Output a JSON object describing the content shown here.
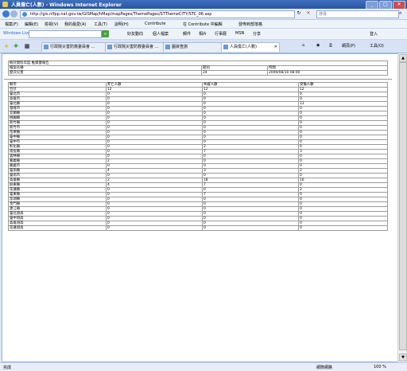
{
  "window": {
    "title": "人員傷亡(人數) - Windows Internet Explorer",
    "minimize": "_",
    "maximize": "□",
    "close": "✕"
  },
  "address": {
    "url": "http://gis.nlfpp.nat.gov.tw/GISMap/hMap/mapPages/ThemePages/STThemeCITY/STC_06.asp",
    "refresh": "↻",
    "stop": "✕"
  },
  "search": {
    "placeholder": "搜尋"
  },
  "menu": [
    "檔案(F)",
    "編輯(E)",
    "檢視(V)",
    "我的最愛(A)",
    "工具(T)",
    "說明(H)",
    "Contribute",
    "在 Contribute 中編輯",
    "發佈到部落格"
  ],
  "livebar": {
    "label": "Windows Live",
    "items": [
      "好友動向",
      "個人檔案",
      "郵件",
      "相片",
      "行事曆",
      "MSN",
      "分享"
    ],
    "signin": "登入"
  },
  "tabs": [
    "行政院災害防救委員會 ...",
    "行政院災害防救委員會 ...",
    "圖資查詢",
    "人員傷亡(人數)"
  ],
  "tab_close": "✕",
  "tools": {
    "page": "網頁(P)",
    "tools": "工具(O)"
  },
  "report": {
    "heading": "統計資料年度 推資暨報告",
    "meta_labels": [
      "檔案名稱",
      "期別",
      "時間"
    ],
    "meta_values": [
      "歷次災害",
      "24",
      "2009/08/10 08:00"
    ]
  },
  "table": {
    "headers": [
      "縣市",
      "死亡人數",
      "失蹤人數",
      "受傷人數"
    ],
    "rows": [
      [
        "合計",
        "12",
        "12",
        "12"
      ],
      [
        "臺北市",
        "0",
        "0",
        "0"
      ],
      [
        "高雄市",
        "0",
        "0",
        "0"
      ],
      [
        "臺北縣",
        "0",
        "0",
        "13"
      ],
      [
        "基隆市",
        "0",
        "0",
        "0"
      ],
      [
        "宜蘭縣",
        "0",
        "0",
        "0"
      ],
      [
        "桃園縣",
        "0",
        "0",
        "0"
      ],
      [
        "新竹縣",
        "0",
        "0",
        "0"
      ],
      [
        "新竹市",
        "0",
        "0",
        "0"
      ],
      [
        "苗栗縣",
        "0",
        "0",
        "0"
      ],
      [
        "臺中縣",
        "0",
        "0",
        "0"
      ],
      [
        "臺中市",
        "0",
        "0",
        "0"
      ],
      [
        "彰化縣",
        "0",
        "2",
        "0"
      ],
      [
        "南投縣",
        "0",
        "7",
        "3"
      ],
      [
        "雲林縣",
        "0",
        "0",
        "0"
      ],
      [
        "嘉義縣",
        "2",
        "0",
        "0"
      ],
      [
        "嘉義市",
        "0",
        "0",
        "0"
      ],
      [
        "臺南縣",
        "4",
        "3",
        "2"
      ],
      [
        "臺南市",
        "0",
        "0",
        "0"
      ],
      [
        "高雄縣",
        "2",
        "18",
        "10"
      ],
      [
        "屏東縣",
        "4",
        "7",
        "0"
      ],
      [
        "花蓮縣",
        "0",
        "0",
        "2"
      ],
      [
        "臺東縣",
        "0",
        "7",
        "0"
      ],
      [
        "澎湖縣",
        "0",
        "0",
        "0"
      ],
      [
        "金門縣",
        "0",
        "0",
        "0"
      ],
      [
        "連江縣",
        "0",
        "0",
        "0"
      ],
      [
        "臺北港高",
        "0",
        "0",
        "0"
      ],
      [
        "臺中港高",
        "0",
        "0",
        "0"
      ],
      [
        "高雄港高",
        "0",
        "0",
        "0"
      ],
      [
        "花蓮港高",
        "0",
        "0",
        "0"
      ]
    ]
  },
  "status": {
    "left": "完成",
    "zone": "網際網路",
    "zoom": "100 %"
  }
}
